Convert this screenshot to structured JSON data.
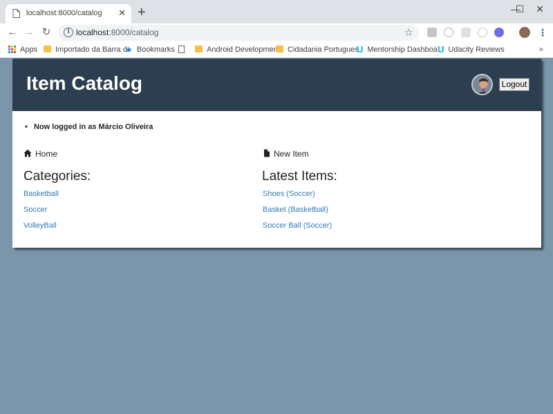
{
  "browser": {
    "tab_title": "localhost:8000/catalog",
    "tab_close": "✕",
    "new_tab": "+",
    "url_host": "localhost",
    "url_path": ":8000/catalog",
    "bookmarks": [
      {
        "label": "Apps",
        "icon": "apps-grid-icon"
      },
      {
        "label": "Importado da Barra d",
        "icon": "folder-icon"
      },
      {
        "label": "Bookmarks",
        "icon": "star-icon"
      },
      {
        "label": "",
        "icon": "page-icon"
      },
      {
        "label": "Android Developmen",
        "icon": "folder-icon"
      },
      {
        "label": "Cidadania Portugues",
        "icon": "folder-icon"
      },
      {
        "label": "Mentorship Dashboa",
        "icon": "udacity-icon"
      },
      {
        "label": "Udacity Reviews",
        "icon": "udacity-icon"
      }
    ],
    "bookmarks_more": "»"
  },
  "header": {
    "title": "Item Catalog",
    "logout_label": "Logout",
    "bg_color": "#2c3e50"
  },
  "flash": {
    "message": "Now logged in as Márcio Oliveira"
  },
  "nav": {
    "home_label": "Home",
    "new_item_label": "New Item"
  },
  "categories": {
    "heading": "Categories:",
    "items": [
      "Basketball",
      "Soccer",
      "VolleyBall"
    ]
  },
  "latest": {
    "heading": "Latest Items:",
    "items": [
      "Shoes (Soccer)",
      "Basket (Basketball)",
      "Soccer Ball (Soccer)"
    ]
  },
  "colors": {
    "page_bg": "#7b96ab",
    "link": "#337ab7"
  }
}
